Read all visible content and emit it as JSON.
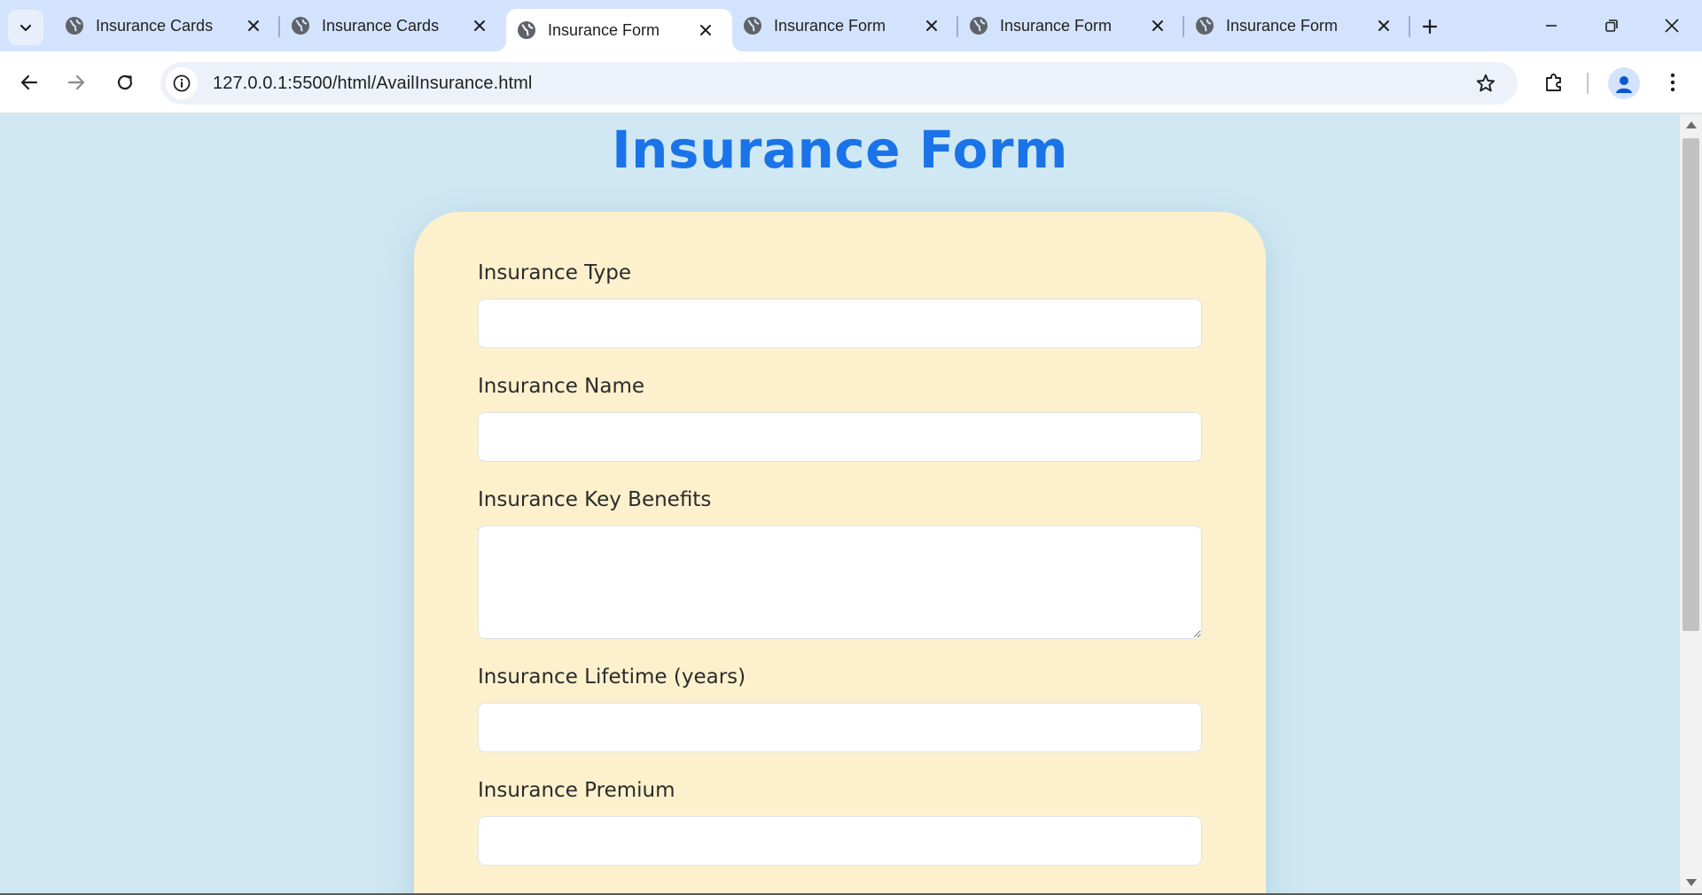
{
  "browser": {
    "tabs": [
      {
        "title": "Insurance Cards",
        "active": false
      },
      {
        "title": "Insurance Cards",
        "active": false
      },
      {
        "title": "Insurance Form",
        "active": true
      },
      {
        "title": "Insurance Form",
        "active": false
      },
      {
        "title": "Insurance Form",
        "active": false
      },
      {
        "title": "Insurance Form",
        "active": false
      }
    ],
    "url": "127.0.0.1:5500/html/AvailInsurance.html"
  },
  "page": {
    "title": "Insurance Form",
    "fields": [
      {
        "label": "Insurance Type",
        "value": ""
      },
      {
        "label": "Insurance Name",
        "value": ""
      },
      {
        "label": "Insurance Key Benefits",
        "value": ""
      },
      {
        "label": "Insurance Lifetime (years)",
        "value": ""
      },
      {
        "label": "Insurance Premium",
        "value": ""
      }
    ]
  },
  "colors": {
    "page_background": "#cfe8f3",
    "card_background": "#fdf1cd",
    "title_color": "#1a73e8",
    "tabstrip_background": "#d3e3fd"
  }
}
